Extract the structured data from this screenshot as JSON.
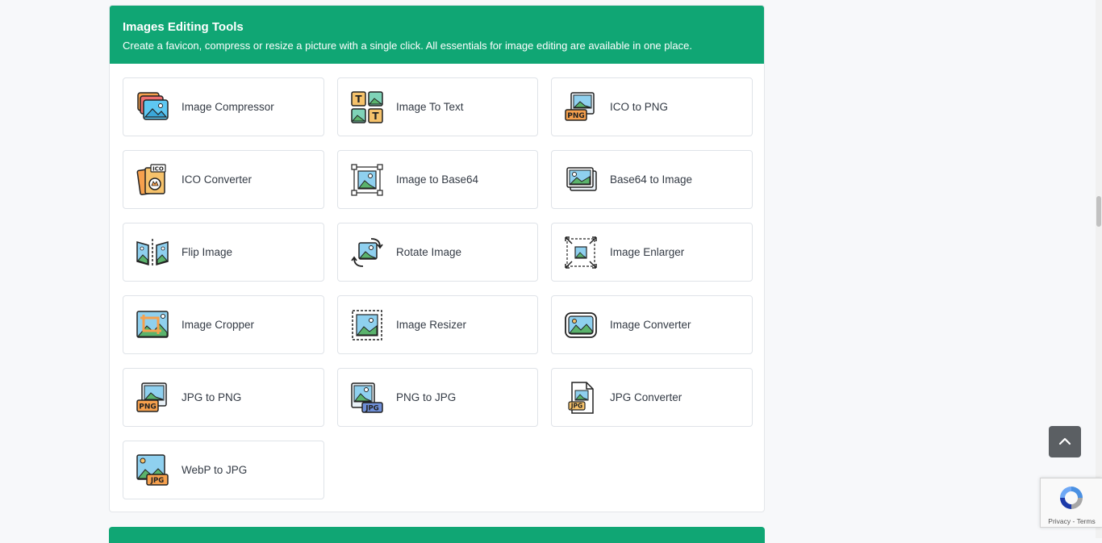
{
  "section": {
    "title": "Images Editing Tools",
    "subtitle": "Create a favicon, compress or resize a picture with a single click. All essentials for image editing are available in one place."
  },
  "tools": [
    {
      "label": "Image Compressor",
      "icon": "image-compressor-icon"
    },
    {
      "label": "Image To Text",
      "icon": "image-to-text-icon"
    },
    {
      "label": "ICO to PNG",
      "icon": "ico-to-png-icon"
    },
    {
      "label": "ICO Converter",
      "icon": "ico-converter-icon"
    },
    {
      "label": "Image to Base64",
      "icon": "image-to-base64-icon"
    },
    {
      "label": "Base64 to Image",
      "icon": "base64-to-image-icon"
    },
    {
      "label": "Flip Image",
      "icon": "flip-image-icon"
    },
    {
      "label": "Rotate Image",
      "icon": "rotate-image-icon"
    },
    {
      "label": "Image Enlarger",
      "icon": "image-enlarger-icon"
    },
    {
      "label": "Image Cropper",
      "icon": "image-cropper-icon"
    },
    {
      "label": "Image Resizer",
      "icon": "image-resizer-icon"
    },
    {
      "label": "Image Converter",
      "icon": "image-converter-icon"
    },
    {
      "label": "JPG to PNG",
      "icon": "jpg-to-png-icon"
    },
    {
      "label": "PNG to JPG",
      "icon": "png-to-jpg-icon"
    },
    {
      "label": "JPG Converter",
      "icon": "jpg-converter-icon"
    },
    {
      "label": "WebP to JPG",
      "icon": "webp-to-jpg-icon"
    }
  ],
  "badges": {
    "png": "PNG",
    "jpg": "JPG",
    "ico": "ICO",
    "t": "T"
  },
  "recaptcha": {
    "text": "Privacy - Terms"
  },
  "colors": {
    "header": "#10a674",
    "text": "#333a44"
  }
}
